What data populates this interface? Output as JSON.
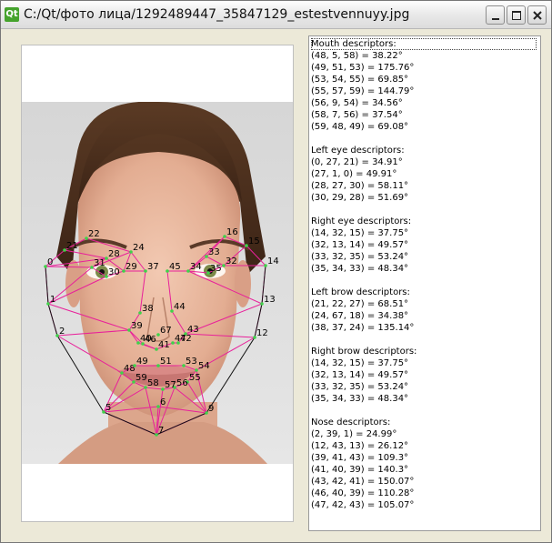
{
  "window": {
    "title": "C:/Qt/фото лица/1292489447_35847129_estestvennuyy.jpg",
    "app_icon_text": "Qt"
  },
  "image": {
    "landmark_color": "#e8209a",
    "labels": [
      "0",
      "1",
      "2",
      "5",
      "6",
      "7",
      "9",
      "12",
      "13",
      "14",
      "15",
      "16",
      "21",
      "22",
      "24",
      "28",
      "29",
      "30",
      "31",
      "32",
      "33",
      "34",
      "35",
      "37",
      "38",
      "39",
      "40",
      "41",
      "42",
      "43",
      "44",
      "45",
      "46",
      "47",
      "48",
      "49",
      "51",
      "53",
      "54",
      "55",
      "56",
      "57",
      "58",
      "59",
      "67"
    ]
  },
  "descriptors": [
    "Mouth descriptors:",
    "(48, 5, 58) = 38.22°",
    "(49, 51, 53) = 175.76°",
    "(53, 54, 55) = 69.85°",
    "(55, 57, 59) = 144.79°",
    "(56, 9, 54) = 34.56°",
    "(58, 7, 56) = 37.54°",
    "(59, 48, 49) = 69.08°",
    "",
    "Left eye descriptors:",
    "(0, 27, 21) = 34.91°",
    "(27, 1, 0) = 49.91°",
    "(28, 27, 30) = 58.11°",
    "(30, 29, 28) = 51.69°",
    "",
    "Right eye descriptors:",
    "(14, 32, 15) = 37.75°",
    "(32, 13, 14) = 49.57°",
    "(33, 32, 35) = 53.24°",
    "(35, 34, 33) = 48.34°",
    "",
    "Left brow descriptors:",
    "(21, 22, 27) = 68.51°",
    "(24, 67, 18) = 34.38°",
    "(38, 37, 24) = 135.14°",
    "",
    "Right brow descriptors:",
    "(14, 32, 15) = 37.75°",
    "(32, 13, 14) = 49.57°",
    "(33, 32, 35) = 53.24°",
    "(35, 34, 33) = 48.34°",
    "",
    "Nose descriptors:",
    "(2, 39, 1) = 24.99°",
    "(12, 43, 13) = 26.12°",
    "(39, 41, 43) = 109.3°",
    "(41, 40, 39) = 140.3°",
    "(43, 42, 41) = 150.07°",
    "(46, 40, 39) = 110.28°",
    "(47, 42, 43) = 105.07°"
  ]
}
